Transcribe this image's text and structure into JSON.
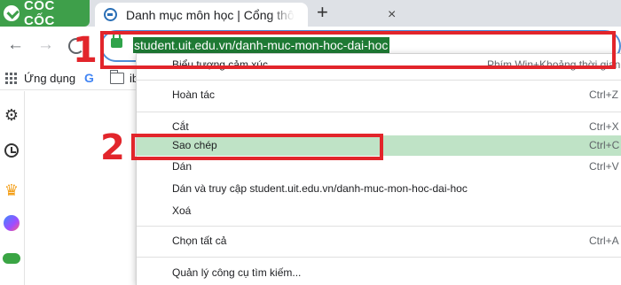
{
  "browser": {
    "brand_name": "CỐC CỐC",
    "brand_color": "#3e9f4a",
    "tab": {
      "title": "Danh mục môn học | Cổng thông tin",
      "close_glyph": "×"
    },
    "new_tab_glyph": "+",
    "nav": {
      "back_glyph": "←",
      "forward_glyph": "→"
    },
    "url": "student.uit.edu.vn/danh-muc-mon-hoc-dai-hoc",
    "url_highlight_color": "#1e7a34"
  },
  "bookmarks": {
    "apps_label": "Ứng dụng",
    "google_glyph": "G",
    "folder_label": "ib"
  },
  "sidepanel": {
    "icons": [
      "gear-icon",
      "history-icon",
      "crown-icon",
      "messenger-icon",
      "gamepad-icon"
    ],
    "gear_glyph": "⚙",
    "crown_glyph": "♛"
  },
  "context_menu": {
    "emoji": {
      "label": "Biểu tượng cảm xúc",
      "shortcut": "Phím Win+Khoảng thời gian"
    },
    "undo": {
      "label": "Hoàn tác",
      "shortcut": "Ctrl+Z"
    },
    "cut": {
      "label": "Cắt",
      "shortcut": "Ctrl+X"
    },
    "copy": {
      "label": "Sao chép",
      "shortcut": "Ctrl+C"
    },
    "paste": {
      "label": "Dán",
      "shortcut": "Ctrl+V"
    },
    "paste_go": {
      "label": "Dán và truy cập student.uit.edu.vn/danh-muc-mon-hoc-dai-hoc"
    },
    "delete": {
      "label": "Xoá"
    },
    "select_all": {
      "label": "Chọn tất cả",
      "shortcut": "Ctrl+A"
    },
    "manage_search": {
      "label": "Quản lý công cụ tìm kiếm..."
    },
    "highlight_color": "#bfe3c6"
  },
  "annotations": {
    "step1": "1",
    "step2": "2",
    "color": "#e2252b"
  }
}
